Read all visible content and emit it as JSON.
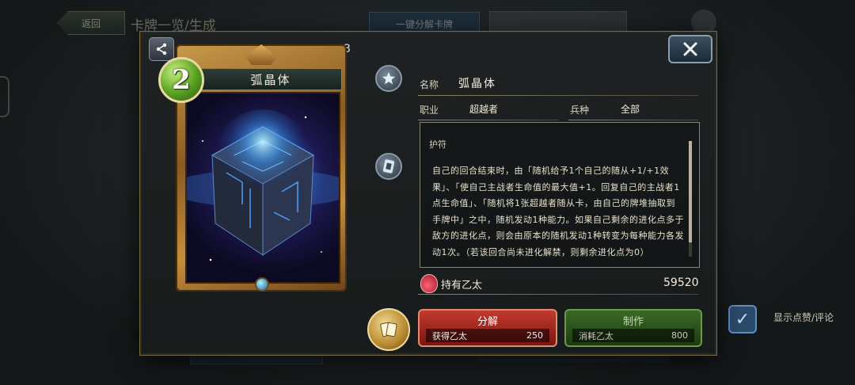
{
  "background": {
    "back_label": "返回",
    "title": "卡牌一览/生成",
    "oneclick_label": "一键分解卡牌",
    "checkbox_label": "显示点赞/评论"
  },
  "modal": {
    "count": "× 3",
    "card": {
      "cost": "2",
      "name": "弧晶体"
    },
    "info": {
      "name_label": "名称",
      "name_value": "弧晶体",
      "class_label": "职业",
      "class_value": "超越者",
      "type_label": "兵种",
      "type_value": "全部",
      "keyword": "护符",
      "description": "自己的回合结束时，由「随机给予1个自己的随从+1/+1效果」、「使自己主战者生命值的最大值+1。回复自己的主战者1点生命值」、「随机将1张超越者随从卡，由自己的牌堆抽取到手牌中」之中，随机发动1种能力。如果自己剩余的进化点多于敌方的进化点，则会由原本的随机发动1种转变为每种能力各发动1次。（若该回合尚未进化解禁，则剩余进化点为0）"
    },
    "ether": {
      "label": "持有乙太",
      "value": "59520"
    },
    "decompose": {
      "title": "分解",
      "sub_label": "获得乙太",
      "sub_value": "250"
    },
    "craft": {
      "title": "制作",
      "sub_label": "消耗乙太",
      "sub_value": "800"
    }
  },
  "colors": {
    "accent_gold": "#c89a4a",
    "decompose_red": "#c23a30",
    "craft_green": "#3a6a24",
    "cost_green": "#58a020"
  },
  "icons": [
    "share-icon",
    "close-icon",
    "star-icon",
    "card-icon",
    "deck-icon",
    "ether-icon",
    "check-icon",
    "settings-icon"
  ]
}
